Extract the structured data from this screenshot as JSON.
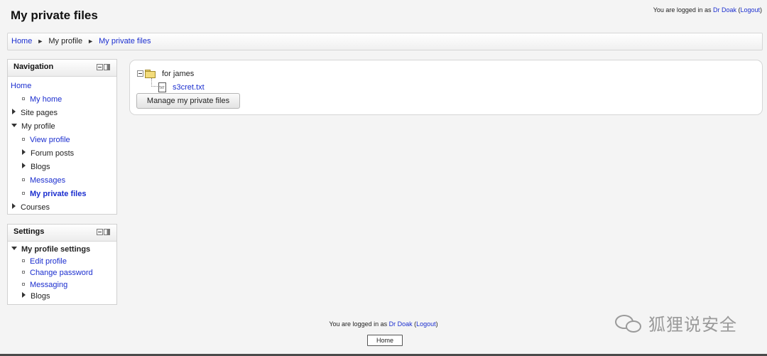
{
  "header": {
    "title": "My private files",
    "login_prefix": "You are logged in as ",
    "user": "Dr Doak",
    "logout_open": " (",
    "logout": "Logout",
    "logout_close": ")"
  },
  "breadcrumb": {
    "items": [
      "Home",
      "My profile",
      "My private files"
    ],
    "separator": "►"
  },
  "navigation": {
    "title": "Navigation",
    "items": [
      {
        "label": "Home"
      },
      {
        "label": "My home"
      },
      {
        "label": "Site pages"
      },
      {
        "label": "My profile"
      },
      {
        "label": "View profile"
      },
      {
        "label": "Forum posts"
      },
      {
        "label": "Blogs"
      },
      {
        "label": "Messages"
      },
      {
        "label": "My private files"
      },
      {
        "label": "Courses"
      }
    ]
  },
  "settings": {
    "title": "Settings",
    "items": [
      {
        "label": "My profile settings"
      },
      {
        "label": "Edit profile"
      },
      {
        "label": "Change password"
      },
      {
        "label": "Messaging"
      },
      {
        "label": "Blogs"
      }
    ]
  },
  "files": {
    "folder": "for james",
    "file": "s3cret.txt",
    "manage_button": "Manage my private files"
  },
  "footer": {
    "login_prefix": "You are logged in as ",
    "user": "Dr Doak",
    "logout_open": " (",
    "logout": "Logout",
    "logout_close": ")",
    "home_button": "Home"
  },
  "watermark": {
    "text": "狐狸说安全"
  },
  "colors": {
    "link": "#1b2ecf",
    "background": "#f4f4f4"
  }
}
